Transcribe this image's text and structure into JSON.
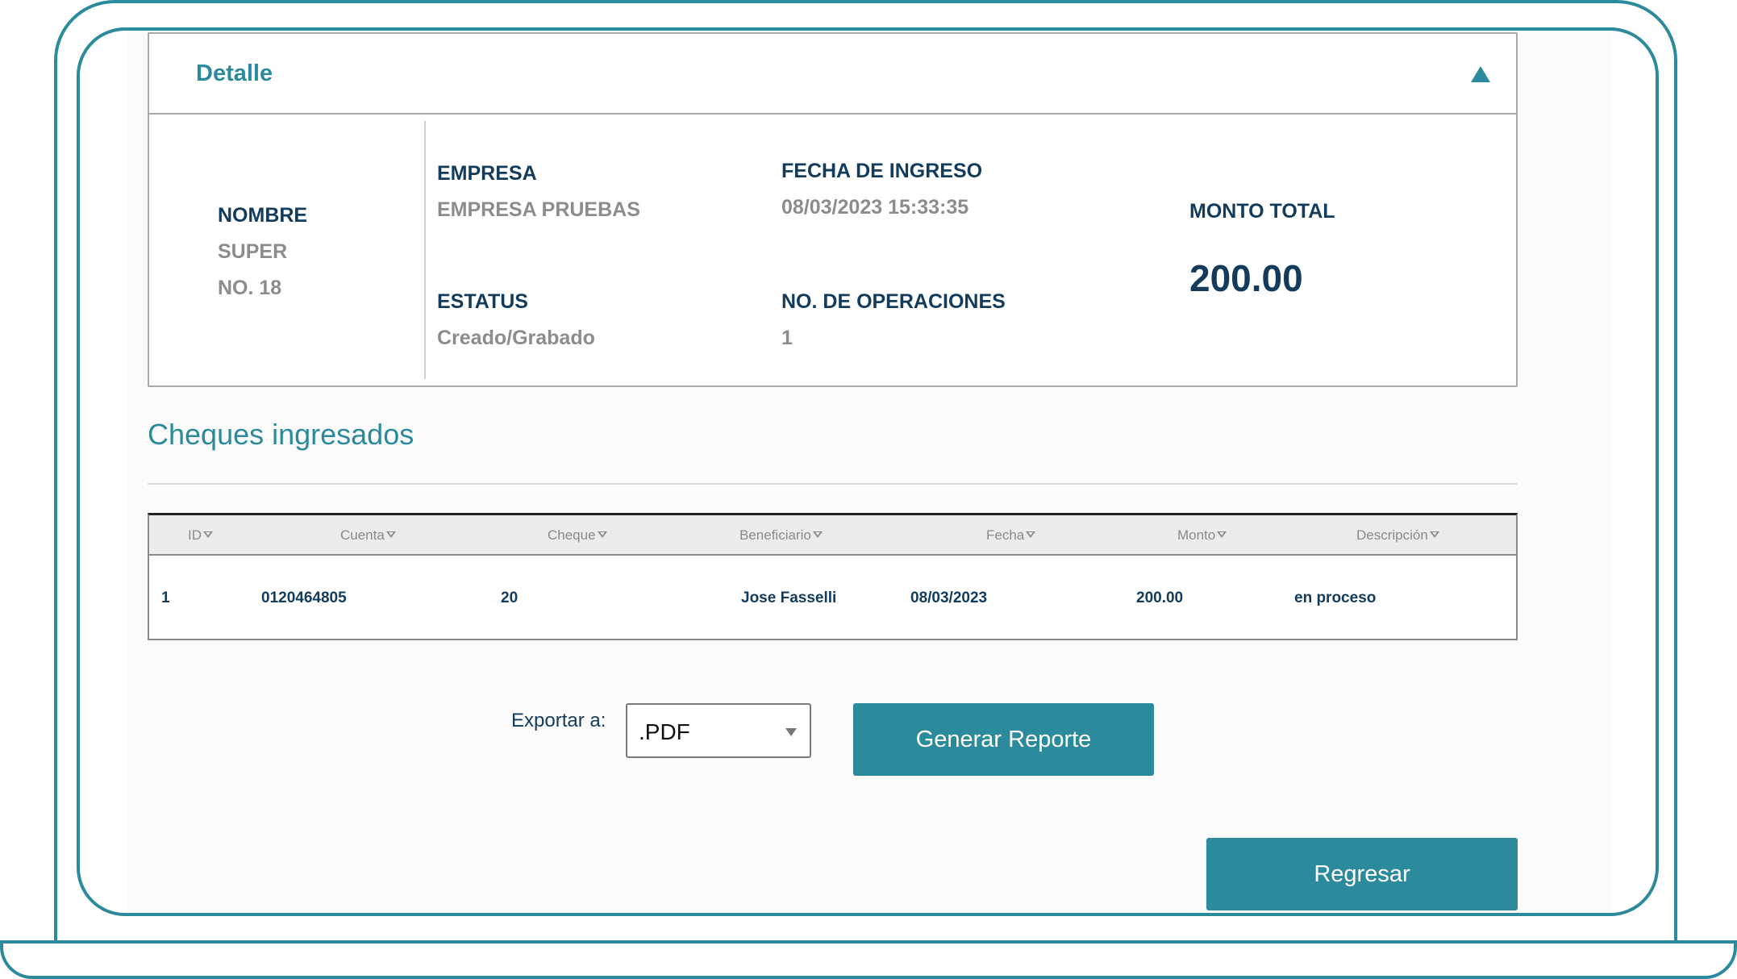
{
  "detail": {
    "title": "Detalle",
    "nombre": {
      "label": "NOMBRE",
      "line1": "SUPER",
      "line2": "NO. 18"
    },
    "empresa": {
      "label": "EMPRESA",
      "value": "EMPRESA PRUEBAS"
    },
    "fecha_ingreso": {
      "label": "FECHA DE INGRESO",
      "value": "08/03/2023 15:33:35"
    },
    "estatus": {
      "label": "ESTATUS",
      "value": "Creado/Grabado"
    },
    "operaciones": {
      "label": "NO. DE OPERACIONES",
      "value": "1"
    },
    "monto_total": {
      "label": "MONTO TOTAL",
      "value": "200.00"
    }
  },
  "cheques": {
    "title": "Cheques ingresados",
    "columns": [
      "ID",
      "Cuenta",
      "Cheque",
      "Beneficiario",
      "Fecha",
      "Monto",
      "Descripción"
    ],
    "rows": [
      [
        "1",
        "0120464805",
        "20",
        "Jose Fasselli",
        "08/03/2023",
        "200.00",
        "en proceso"
      ]
    ]
  },
  "export": {
    "label": "Exportar a:",
    "selected": ".PDF",
    "generate_label": "Generar Reporte"
  },
  "back_label": "Regresar",
  "colors": {
    "accent": "#2b8a9c",
    "navy": "#123b5c",
    "muted": "#8c8c8c"
  }
}
